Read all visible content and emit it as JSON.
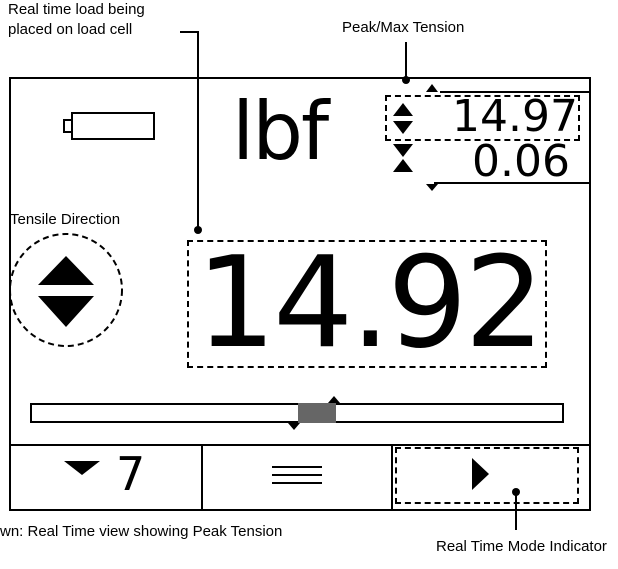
{
  "annotations": {
    "real_time_load": "Real time load being\nplaced on load cell",
    "peak_max_tension": "Peak/Max Tension",
    "tensile_direction": "Tensile Direction",
    "real_time_mode_indicator": "Real Time Mode Indicator",
    "caption": "wn: Real Time view showing Peak Tension"
  },
  "display": {
    "unit": "lbf",
    "peak_max": "14.97",
    "peak_min": "0.06",
    "load": "14.92",
    "footer_left_value": "7",
    "icons": {
      "battery": "battery-icon",
      "max_marker": "max-arrows-icon",
      "min_marker": "min-arrows-icon",
      "direction": "tensile-direction-icon",
      "menu": "menu-icon",
      "mode": "play-icon",
      "down": "down-triangle-icon"
    }
  }
}
